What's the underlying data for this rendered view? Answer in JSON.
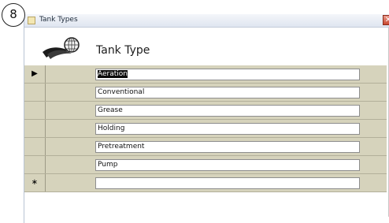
{
  "callout": {
    "number": "8"
  },
  "window": {
    "title": "Tank Types",
    "close_label": "✕"
  },
  "form": {
    "heading": "Tank Type"
  },
  "record_selector": {
    "current": "▶",
    "new": "∗"
  },
  "rows": [
    {
      "value": "Aeration",
      "selected": true
    },
    {
      "value": "Conventional"
    },
    {
      "value": "Grease"
    },
    {
      "value": "Holding"
    },
    {
      "value": "Pretreatment"
    },
    {
      "value": "Pump"
    },
    {
      "value": ""
    }
  ],
  "icons": {
    "window": "form-icon",
    "logo": "globe-swoosh-logo",
    "close": "close-icon"
  }
}
